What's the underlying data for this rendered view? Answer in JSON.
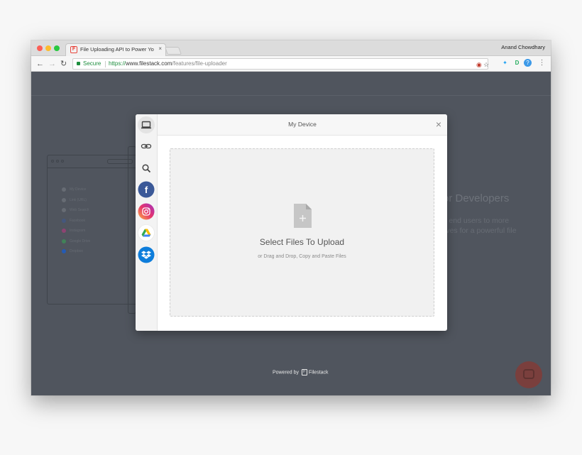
{
  "browser": {
    "tab_title": "File Uploading API to Power Yo",
    "tab_close": "×",
    "profile_name": "Anand Chowdhary",
    "secure_label": "Secure",
    "url_protocol": "https://",
    "url_host": "www.filestack.com",
    "url_path": "/features/file-uploader",
    "back": "←",
    "forward": "→",
    "reload": "↻",
    "star": "☆",
    "menu": "⋮"
  },
  "page": {
    "heading_partial": "or Developers",
    "subtext_line1": "r end users to more",
    "subtext_line2": "lves for a powerful file"
  },
  "ghost_ui": {
    "items": [
      "My Device",
      "Link (URL)",
      "Web Search",
      "Facebook",
      "Instagram",
      "Google Drive",
      "Dropbox"
    ],
    "colors": [
      "#7a7f86",
      "#7a7f86",
      "#7a7f86",
      "#3b5998",
      "#c13584",
      "#34a853",
      "#0061fe"
    ]
  },
  "picker": {
    "title": "My Device",
    "close": "×",
    "drop_title": "Select Files To Upload",
    "drop_subtitle": "or Drag and Drop, Copy and Paste Files",
    "sources": [
      {
        "name": "my-device",
        "icon": "laptop-icon"
      },
      {
        "name": "link",
        "icon": "link-icon"
      },
      {
        "name": "web-search",
        "icon": "search-icon"
      },
      {
        "name": "facebook",
        "icon": "facebook-icon",
        "color": "#3b5998"
      },
      {
        "name": "instagram",
        "icon": "instagram-icon",
        "color": "#d6249f"
      },
      {
        "name": "google-drive",
        "icon": "google-drive-icon",
        "color": "#ffffff"
      },
      {
        "name": "dropbox",
        "icon": "dropbox-icon",
        "color": "#0d7ddb"
      }
    ]
  },
  "footer": {
    "powered_by": "Powered by",
    "brand": "Filestack"
  }
}
